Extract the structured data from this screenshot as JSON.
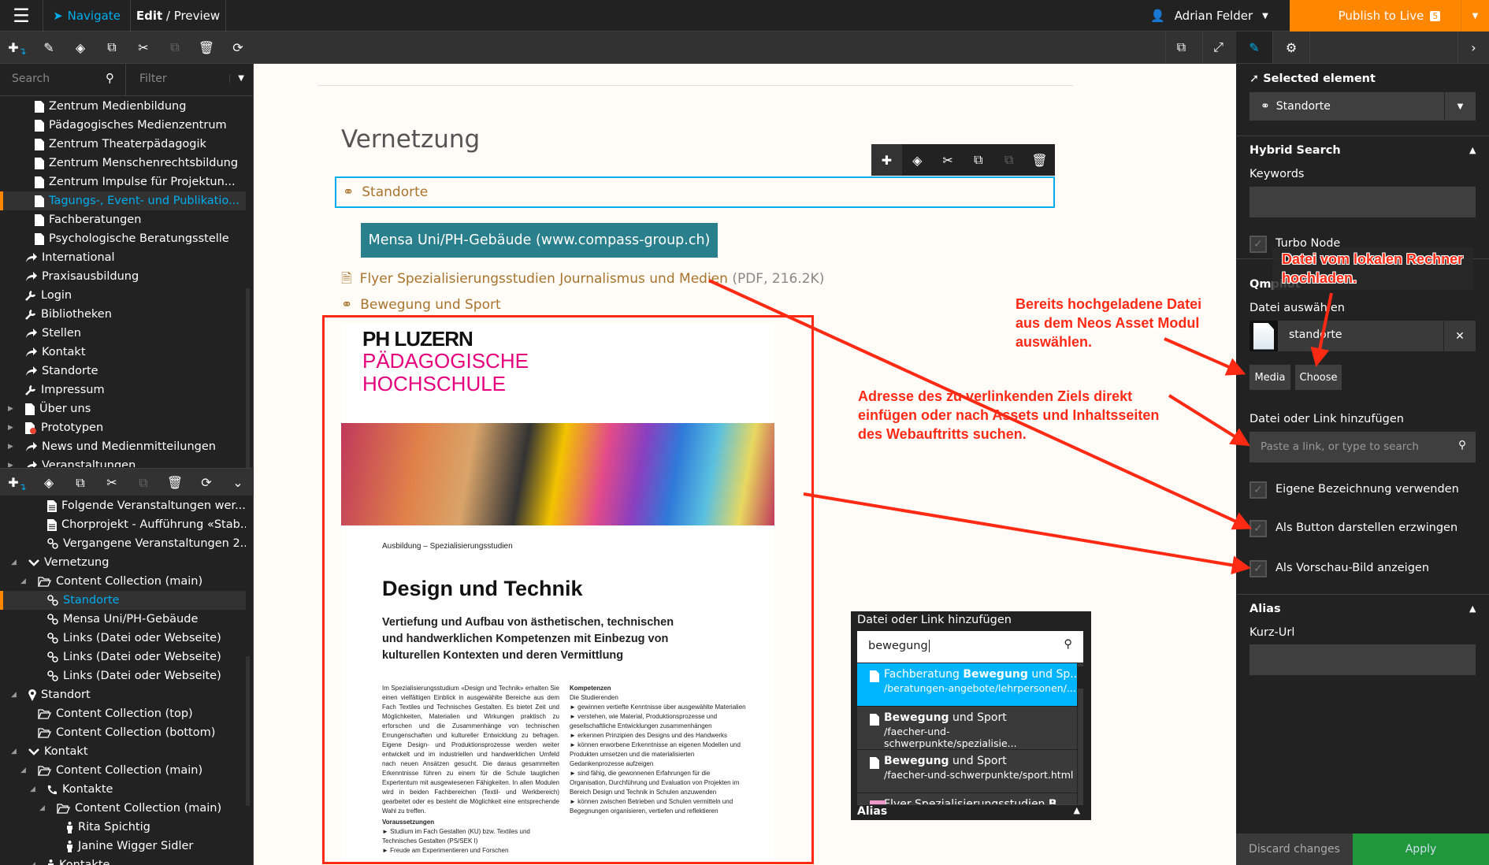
{
  "topbar": {
    "navigate": "Navigate",
    "edit": "Edit",
    "preview": "Preview",
    "user": "Adrian Felder",
    "publish": "Publish to Live",
    "publish_count": "5"
  },
  "left": {
    "search_placeholder": "Search",
    "filter_placeholder": "Filter",
    "tree1": [
      {
        "label": "Zentrum Medienbildung",
        "icon": "document",
        "level": 2
      },
      {
        "label": "Pädagogisches Medienzentrum",
        "icon": "document",
        "level": 2
      },
      {
        "label": "Zentrum Theaterpädagogik",
        "icon": "document",
        "level": 2
      },
      {
        "label": "Zentrum Menschenrechtsbildung",
        "icon": "document",
        "level": 2
      },
      {
        "label": "Zentrum Impulse für Projektun...",
        "icon": "document",
        "level": 2
      },
      {
        "label": "Tagungs-, Event- und Publikatio...",
        "icon": "document",
        "level": 2,
        "active": true
      },
      {
        "label": "Fachberatungen",
        "icon": "document",
        "level": 2
      },
      {
        "label": "Psychologische Beratungsstelle",
        "icon": "document",
        "level": 2
      },
      {
        "label": "International",
        "icon": "shortcut",
        "level": 1
      },
      {
        "label": "Praxisausbildung",
        "icon": "shortcut",
        "level": 1
      },
      {
        "label": "Login",
        "icon": "wrench",
        "level": 1
      },
      {
        "label": "Bibliotheken",
        "icon": "wrench",
        "level": 1
      },
      {
        "label": "Stellen",
        "icon": "shortcut",
        "level": 1
      },
      {
        "label": "Kontakt",
        "icon": "shortcut",
        "level": 1
      },
      {
        "label": "Standorte",
        "icon": "shortcut",
        "level": 1
      },
      {
        "label": "Impressum",
        "icon": "wrench",
        "level": 1
      },
      {
        "label": "Über uns",
        "icon": "document",
        "level": 1,
        "expandable": true
      },
      {
        "label": "Prototypen",
        "icon": "document-error",
        "level": 1,
        "expandable": true
      },
      {
        "label": "News und Medienmitteilungen",
        "icon": "shortcut",
        "level": 1,
        "expandable": true
      },
      {
        "label": "Veranstaltungen",
        "icon": "shortcut",
        "level": 1,
        "expandable": true
      }
    ],
    "tree2": [
      {
        "label": "Folgende Veranstaltungen wer...",
        "icon": "text",
        "level": 3
      },
      {
        "label": "Chorprojekt - Aufführung «Stab...",
        "icon": "text",
        "level": 3
      },
      {
        "label": "Vergangene Veranstaltungen 2...",
        "icon": "link",
        "level": 3
      },
      {
        "label": "Vernetzung",
        "icon": "chevron",
        "level": 1,
        "expandable": true
      },
      {
        "label": "Content Collection (main)",
        "icon": "folder",
        "level": 2,
        "expandable": true
      },
      {
        "label": "Standorte",
        "icon": "link",
        "level": 3,
        "active": true
      },
      {
        "label": "Mensa Uni/PH-Gebäude",
        "icon": "link",
        "level": 3
      },
      {
        "label": "Links (Datei oder Webseite)",
        "icon": "link",
        "level": 3
      },
      {
        "label": "Links (Datei oder Webseite)",
        "icon": "link",
        "level": 3
      },
      {
        "label": "Links (Datei oder Webseite)",
        "icon": "link",
        "level": 3
      },
      {
        "label": "Standort",
        "icon": "pin",
        "level": 1,
        "expandable": true
      },
      {
        "label": "Content Collection (top)",
        "icon": "folder",
        "level": 2
      },
      {
        "label": "Content Collection (bottom)",
        "icon": "folder",
        "level": 2
      },
      {
        "label": "Kontakt",
        "icon": "chevron",
        "level": 1,
        "expandable": true
      },
      {
        "label": "Content Collection (main)",
        "icon": "folder",
        "level": 2,
        "expandable": true
      },
      {
        "label": "Kontakte",
        "icon": "phone",
        "level": 3,
        "expandable": true
      },
      {
        "label": "Content Collection (main)",
        "icon": "folder",
        "level": 4,
        "expandable": true
      },
      {
        "label": "Rita Spichtig",
        "icon": "person",
        "level": 5
      },
      {
        "label": "Janine Wigger Sidler",
        "icon": "person",
        "level": 5
      },
      {
        "label": "Kontakte",
        "icon": "person",
        "level": 3,
        "expandable": true
      }
    ]
  },
  "canvas": {
    "heading": "Vernetzung",
    "selected_link": "Standorte",
    "mensa_button": "Mensa Uni/PH-Gebäude (www.compass-group.ch)",
    "flyer_link": "Flyer Spezialisierungsstudien Journalismus und Medien",
    "flyer_meta": "(PDF, 216.2K)",
    "sport_link": "Bewegung und Sport",
    "flyer": {
      "logo_line1": "PH LUZERN",
      "logo_line2": "PÄDAGOGISCHE",
      "logo_line3": "HOCHSCHULE",
      "kicker": "Ausbildung – Spezialisierungsstudien",
      "title": "Design und Technik",
      "lead": "Vertiefung und Aufbau von ästhetischen, technischen und handwerklichen Kompetenzen mit Einbezug von kulturellen Kontexten und deren Vermittlung",
      "body": "Im Spezialisierungsstudium «Design und Technik» erhalten Sie einen vielfältigen Einblick in ausgewählte Bereiche aus dem Fach Textiles und Technisches Gestalten. Es bietet Zeit und Möglichkeiten, Materialien und Wirkungen praktisch zu erforschen und die Zusammenhänge von technischen Errungenschaften und kultureller Entwicklung zu befragen. Eigene Design- und Produktionsprozesse werden weiter entwickelt und im industriellen und handwerklichen Umfeld nach neuen Ansätzen gesucht. Die daraus gesammelten Erkenntnisse führen zu einem für die Schule tauglichen Expertentum mit ausgewiesenen Fähigkeiten. In allen Modulen wird in beiden Fachbereichen (Textil- und Werkbereich) gearbeitet oder es besteht die Möglichkeit eine entsprechende Wahl zu treffen.",
      "req_title": "Voraussetzungen",
      "req": [
        "Studium im Fach Gestalten (KU) bzw. Textiles und Technisches Gestalten (PS/SEK I)",
        "Freude am Experimentieren und Forschen"
      ],
      "comp_title": "Kompetenzen",
      "comp_intro": "Die Studierenden",
      "comp": [
        "gewinnen vertiefte Kenntnisse über ausgewählte Materialien",
        "verstehen, wie Material, Produktionsprozesse und gesellschaftliche Entwicklungen zusammenhängen",
        "erkennen Prinzipien des Designs und des Handwerks",
        "können erworbene Erkenntnisse an eigenen Modellen und Produkten umsetzen und die materialisierten Gedankenprozesse aufzeigen",
        "sind fähig, die gewonnenen Erfahrungen für die Organisation, Durchführung und Evaluation von Projekten im Bereich Design und Technik in Schulen anzuwenden",
        "können zwischen Betrieben und Schulen vermitteln und Begegnungen organisieren, vertiefen und reflektieren"
      ]
    }
  },
  "popup": {
    "title": "Datei oder Link hinzufügen",
    "query": "bewegung",
    "results": [
      {
        "pre": "Fachberatung ",
        "bold": "Bewegung",
        "post": " und Sp...",
        "path": "/beratungen-angebote/lehrpersonen/..."
      },
      {
        "pre": "",
        "bold": "Bewegung",
        "post": " und Sport",
        "path": "/faecher-und-schwerpunkte/spezialisie..."
      },
      {
        "pre": "",
        "bold": "Bewegung",
        "post": " und Sport",
        "path": "/faecher-und-schwerpunkte/sport.html"
      },
      {
        "pre": "Flyer Spezialisierungsstudien ",
        "bold": "B",
        "post": "",
        "path": ""
      }
    ],
    "alias": "Alias"
  },
  "right": {
    "selected_element": "Selected element",
    "selected_value": "Standorte",
    "hybrid_search": "Hybrid Search",
    "keywords": "Keywords",
    "turbo_node": "Turbo Node",
    "qmpilot": "Qmpilot",
    "datei_auswaehlen": "Datei auswählen",
    "file_name": "standorte",
    "media": "Media",
    "choose": "Choose",
    "link_label": "Datei oder Link hinzufügen",
    "link_placeholder": "Paste a link, or type to search",
    "cb1": "Eigene Bezeichnung verwenden",
    "cb2": "Als Button darstellen erzwingen",
    "cb3": "Als Vorschau-Bild anzeigen",
    "alias": "Alias",
    "kurz_url": "Kurz-Url",
    "discard": "Discard changes",
    "apply": "Apply"
  },
  "annotations": {
    "upload": "Datei vom lokalen Rechner hochladen.",
    "media": "Bereits hochgeladene Datei aus dem Neos Asset Modul auswählen.",
    "link": "Adresse des zu verlinkenden Ziels direkt einfügen oder nach Assets und Inhaltsseiten des Webauftritts suchen."
  },
  "colors": {
    "accent": "#00adee",
    "publish": "#ff8700",
    "apply": "#21973c",
    "annotation": "#ff2a14",
    "link": "#a8732c",
    "teal": "#2a7f8c"
  }
}
